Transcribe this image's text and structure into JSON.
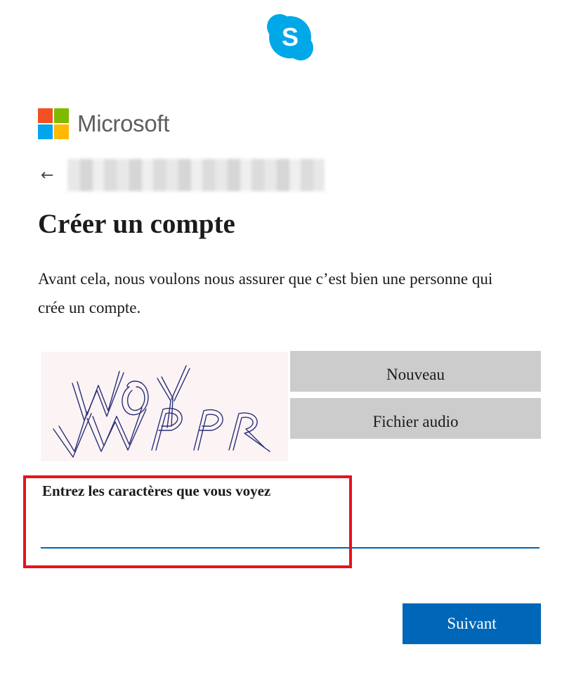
{
  "app_icon": "skype-icon",
  "brand": {
    "name": "Microsoft",
    "logo_colors": [
      "#f25022",
      "#7fba00",
      "#00a4ef",
      "#ffb900"
    ]
  },
  "identity": {
    "back_icon": "back-arrow-icon",
    "back_glyph": "←"
  },
  "page": {
    "title": "Créer un compte",
    "description": "Avant cela, nous voulons nous assurer que c’est bien une personne qui crée un compte."
  },
  "captcha": {
    "image_text": "WOY VWPR",
    "new_label": "Nouveau",
    "audio_label": "Fichier audio",
    "field_label": "Entrez les caractères que vous voyez",
    "field_value": ""
  },
  "actions": {
    "next_label": "Suivant"
  },
  "colors": {
    "accent": "#0067b8",
    "highlight": "#e8121c",
    "captcha_ink": "#2a2f7a",
    "captcha_bg": "#fcf4f4"
  }
}
